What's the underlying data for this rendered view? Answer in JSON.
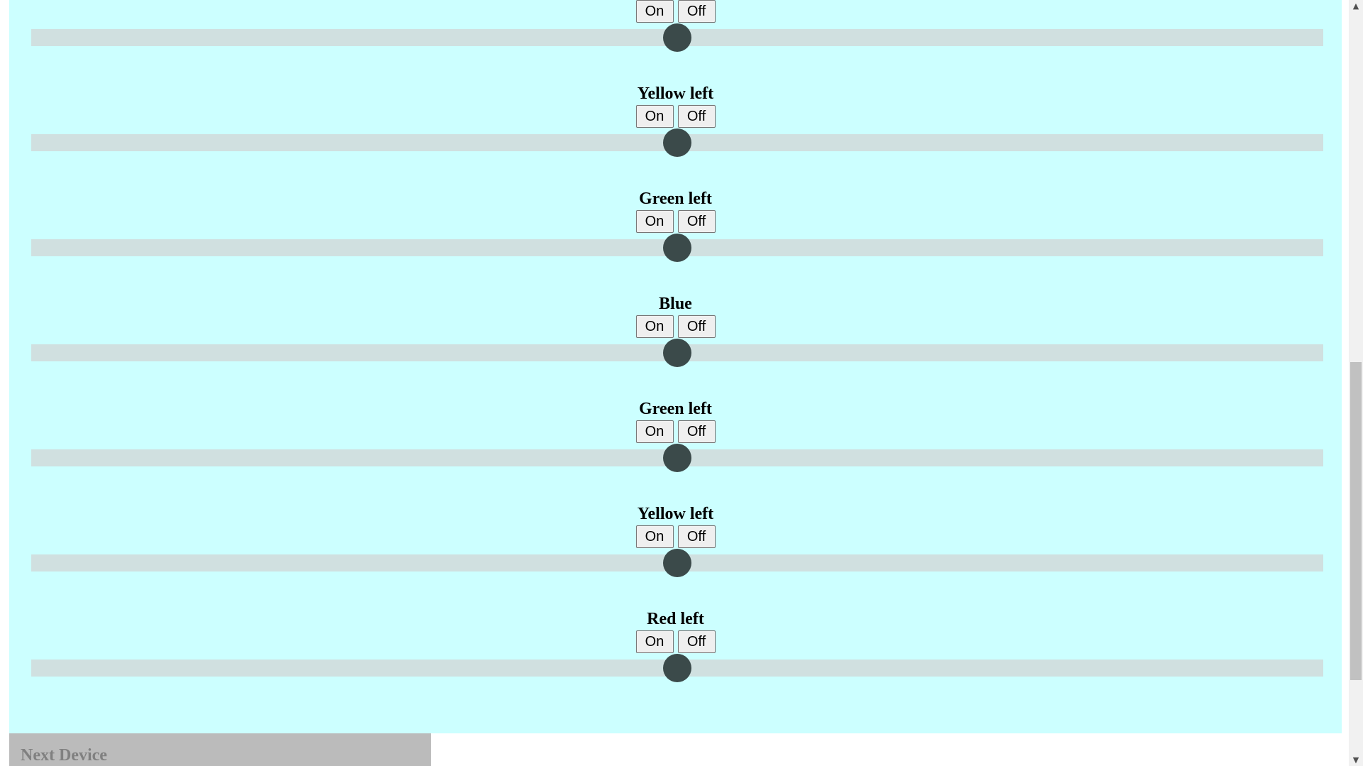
{
  "colors": {
    "panel_background": "#ccffff",
    "slider_track": "#d0e0e0",
    "slider_thumb": "#3b4a4a",
    "next_device_background": "#bbbbbb",
    "next_device_text": "#808080"
  },
  "controls": [
    {
      "title": "",
      "on_label": "On",
      "off_label": "Off",
      "slider_value_fraction": 0.5
    },
    {
      "title": "Yellow left",
      "on_label": "On",
      "off_label": "Off",
      "slider_value_fraction": 0.5
    },
    {
      "title": "Green left",
      "on_label": "On",
      "off_label": "Off",
      "slider_value_fraction": 0.5
    },
    {
      "title": "Blue",
      "on_label": "On",
      "off_label": "Off",
      "slider_value_fraction": 0.5
    },
    {
      "title": "Green left",
      "on_label": "On",
      "off_label": "Off",
      "slider_value_fraction": 0.5
    },
    {
      "title": "Yellow left",
      "on_label": "On",
      "off_label": "Off",
      "slider_value_fraction": 0.5
    },
    {
      "title": "Red left",
      "on_label": "On",
      "off_label": "Off",
      "slider_value_fraction": 0.5
    }
  ],
  "next_device": {
    "label": "Next Device"
  },
  "scrollbar": {
    "up_icon": "scroll-up-arrow-icon",
    "down_icon": "scroll-down-arrow-icon"
  }
}
